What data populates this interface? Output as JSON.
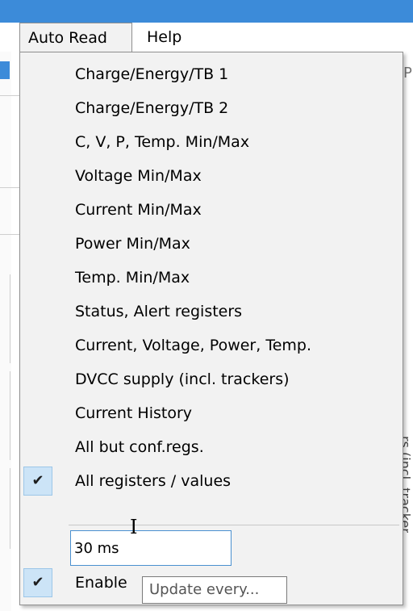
{
  "menubar": {
    "auto_read": "Auto Read",
    "help": "Help"
  },
  "background": {
    "right_top": "P",
    "right_side": "rs (incl. trackers)"
  },
  "menu": {
    "items": [
      {
        "label": "Charge/Energy/TB 1",
        "checked": false
      },
      {
        "label": "Charge/Energy/TB 2",
        "checked": false
      },
      {
        "label": "C, V, P, Temp. Min/Max",
        "checked": false
      },
      {
        "label": "Voltage Min/Max",
        "checked": false
      },
      {
        "label": "Current Min/Max",
        "checked": false
      },
      {
        "label": "Power Min/Max",
        "checked": false
      },
      {
        "label": "Temp. Min/Max",
        "checked": false
      },
      {
        "label": "Status, Alert registers",
        "checked": false
      },
      {
        "label": "Current, Voltage, Power, Temp.",
        "checked": false
      },
      {
        "label": "DVCC supply (incl. trackers)",
        "checked": false
      },
      {
        "label": "Current History",
        "checked": false
      },
      {
        "label": "All but conf.regs.",
        "checked": false
      },
      {
        "label": "All registers / values",
        "checked": true
      }
    ],
    "interval_value": "30 ms",
    "enable_label": "Enable",
    "enable_checked": true,
    "check_glyph": "✔"
  },
  "tooltip": {
    "text": "Update every..."
  },
  "colors": {
    "titlebar": "#3c8bd9",
    "menu_bg": "#f2f2f2",
    "check_bg": "#cce4f7",
    "textbox_border": "#4a90d0"
  },
  "icons": [
    "checkmark-icon",
    "ibeam-cursor-icon"
  ]
}
